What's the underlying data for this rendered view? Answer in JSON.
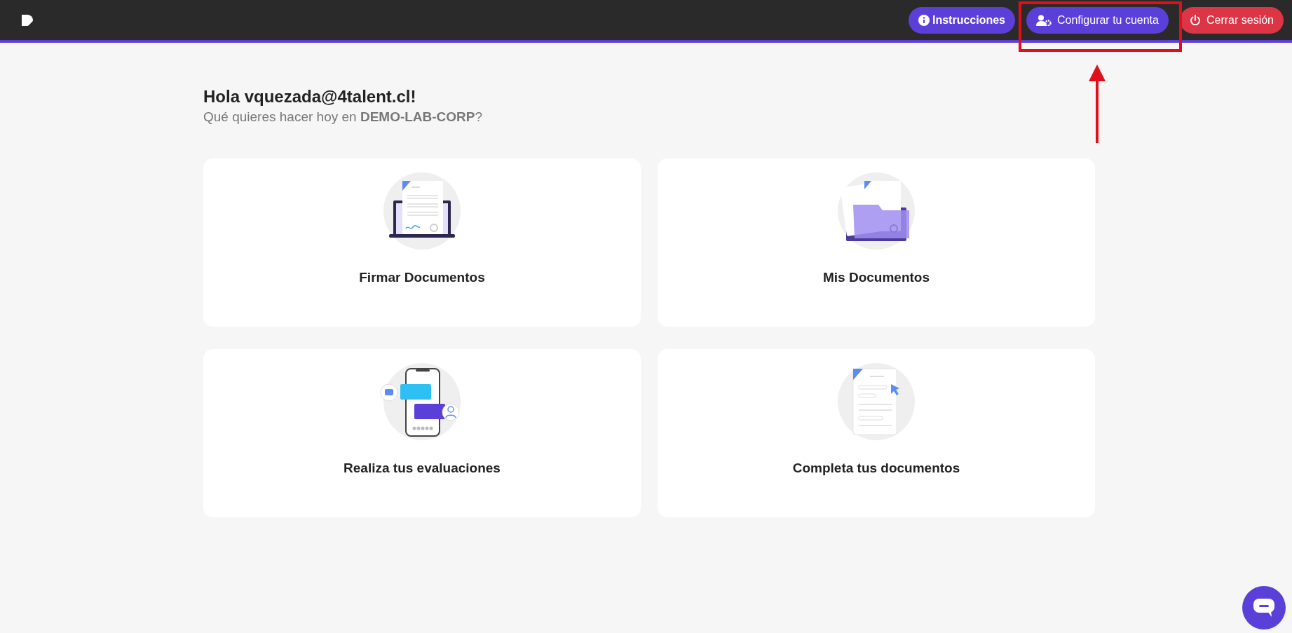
{
  "header": {
    "buttons": [
      {
        "label": "Instrucciones",
        "kind": "info"
      },
      {
        "label": "Configurar tu cuenta",
        "kind": "account"
      },
      {
        "label": "Cerrar sesión",
        "kind": "logout"
      }
    ]
  },
  "greeting": {
    "title": "Hola vquezada@4talent.cl!",
    "subtitle": "Qué quieres hacer hoy en **DEMO-LAB-CORP**?"
  },
  "cards": [
    {
      "title": "Firmar Documentos",
      "kind": "sign"
    },
    {
      "title": "Mis Documentos",
      "kind": "folder"
    },
    {
      "title": "Realiza tus evaluaciones",
      "kind": "chat"
    },
    {
      "title": "Completa tus documentos",
      "kind": "form"
    }
  ]
}
